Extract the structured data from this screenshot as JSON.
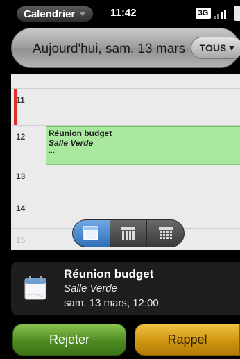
{
  "status_bar": {
    "app_menu_label": "Calendrier",
    "clock": "11:42",
    "network": "3G"
  },
  "header": {
    "title": "Aujourd'hui, sam. 13 mars",
    "filter_label": "TOUS"
  },
  "day_view": {
    "hours": [
      "11",
      "12",
      "13",
      "14",
      "15"
    ],
    "event": {
      "title": "Réunion budget",
      "location": "Salle Verde",
      "more": "...",
      "color": "#a9e89e"
    },
    "now_marker_color": "#d8322a",
    "view_switch": {
      "options": [
        "day-view-icon",
        "week-view-icon",
        "month-view-icon"
      ],
      "active": "day-view-icon",
      "active_color": "#3f82cf"
    }
  },
  "notification": {
    "icon": "calendar-icon",
    "title": "Réunion budget",
    "location": "Salle Verde",
    "time": "sam. 13 mars, 12:00"
  },
  "actions": {
    "reject_label": "Rejeter",
    "reject_color": "#5a9a2b",
    "remind_label": "Rappel",
    "remind_color": "#d99c14"
  }
}
